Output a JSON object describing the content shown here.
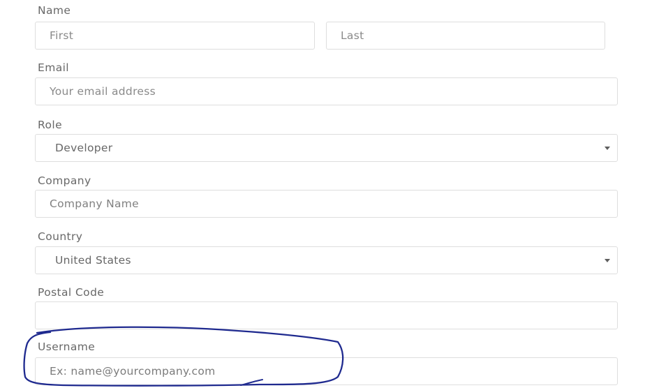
{
  "form": {
    "name": {
      "label": "Name",
      "first_placeholder": "First",
      "last_placeholder": "Last"
    },
    "email": {
      "label": "Email",
      "placeholder": "Your email address"
    },
    "role": {
      "label": "Role",
      "selected": "Developer"
    },
    "company": {
      "label": "Company",
      "placeholder": "Company Name"
    },
    "country": {
      "label": "Country",
      "selected": "United States"
    },
    "postal_code": {
      "label": "Postal Code",
      "placeholder": ""
    },
    "username": {
      "label": "Username",
      "placeholder": "Ex: name@yourcompany.com"
    }
  },
  "annotation": {
    "color": "#1f2a8f"
  },
  "icons": {
    "select_caret": "chevron-down-icon"
  }
}
